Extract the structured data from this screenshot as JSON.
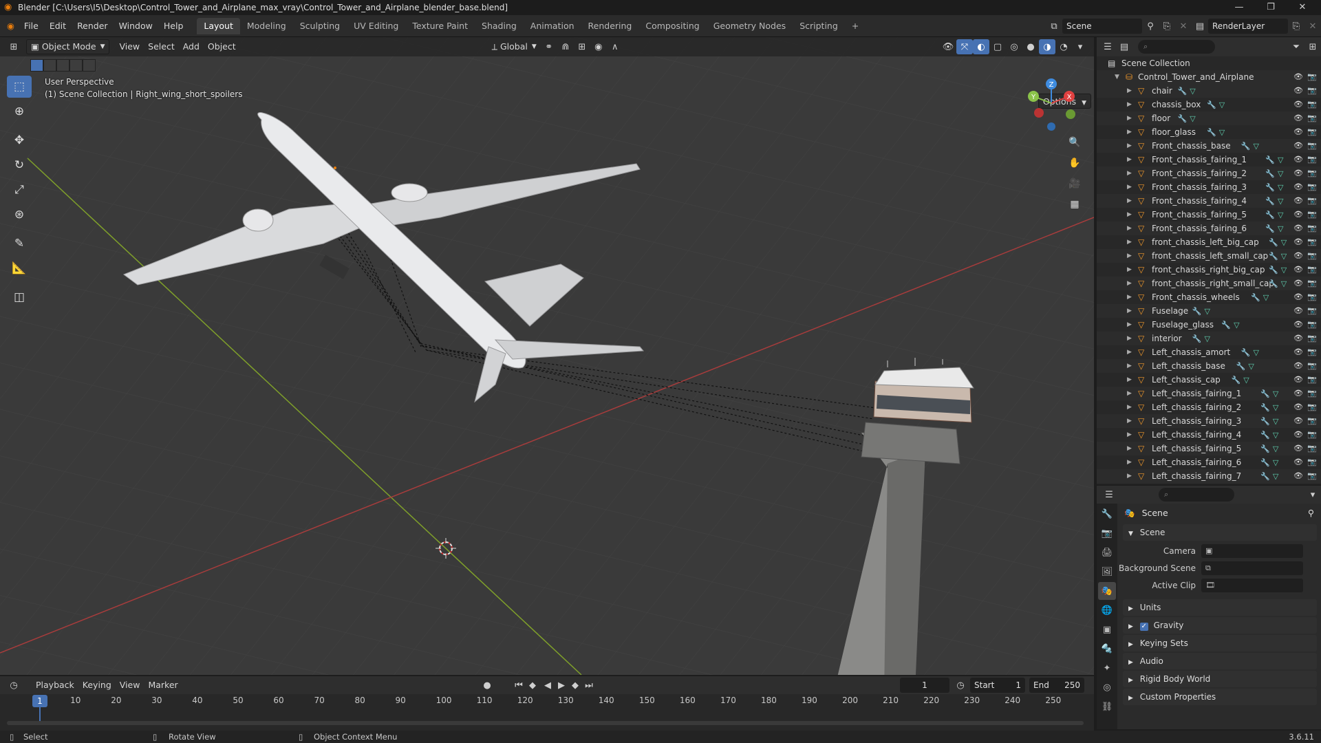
{
  "window": {
    "title": "Blender [C:\\Users\\I5\\Desktop\\Control_Tower_and_Airplane_max_vray\\Control_Tower_and_Airplane_blender_base.blend]"
  },
  "menus": [
    "File",
    "Edit",
    "Render",
    "Window",
    "Help"
  ],
  "workspaces": [
    "Layout",
    "Modeling",
    "Sculpting",
    "UV Editing",
    "Texture Paint",
    "Shading",
    "Animation",
    "Rendering",
    "Compositing",
    "Geometry Nodes",
    "Scripting"
  ],
  "active_workspace": "Layout",
  "scene_selector": {
    "scene": "Scene",
    "view_layer": "RenderLayer"
  },
  "viewport": {
    "mode": "Object Mode",
    "menus": [
      "View",
      "Select",
      "Add",
      "Object"
    ],
    "orientation": "Global",
    "options_label": "Options",
    "info_line1": "User Perspective",
    "info_line2": "(1) Scene Collection | Right_wing_short_spoilers",
    "gizmo_axes": {
      "x": "X",
      "y": "Y",
      "z": "Z"
    }
  },
  "outliner": {
    "search_placeholder": "",
    "root": "Scene Collection",
    "collection": "Control_Tower_and_Airplane",
    "objects": [
      "chair",
      "chassis_box",
      "floor",
      "floor_glass",
      "Front_chassis_base",
      "Front_chassis_fairing_1",
      "Front_chassis_fairing_2",
      "Front_chassis_fairing_3",
      "Front_chassis_fairing_4",
      "Front_chassis_fairing_5",
      "Front_chassis_fairing_6",
      "front_chassis_left_big_cap",
      "front_chassis_left_small_cap",
      "front_chassis_right_big_cap",
      "front_chassis_right_small_cap",
      "Front_chassis_wheels",
      "Fuselage",
      "Fuselage_glass",
      "interior",
      "Left_chassis_amort",
      "Left_chassis_base",
      "Left_chassis_cap",
      "Left_chassis_fairing_1",
      "Left_chassis_fairing_2",
      "Left_chassis_fairing_3",
      "Left_chassis_fairing_4",
      "Left_chassis_fairing_5",
      "Left_chassis_fairing_6",
      "Left_chassis_fairing_7"
    ]
  },
  "properties": {
    "context": "Scene",
    "panel_scene": "Scene",
    "fields": [
      {
        "label": "Camera"
      },
      {
        "label": "Background Scene"
      },
      {
        "label": "Active Clip"
      }
    ],
    "collapsed_panels": [
      "Units",
      "Gravity",
      "Keying Sets",
      "Audio",
      "Rigid Body World",
      "Custom Properties"
    ],
    "gravity_checked": true
  },
  "timeline": {
    "menus": [
      "Playback",
      "Keying",
      "View",
      "Marker"
    ],
    "current_frame": "1",
    "start_label": "Start",
    "start_value": "1",
    "end_label": "End",
    "end_value": "250",
    "ticks": [
      "10",
      "20",
      "30",
      "40",
      "50",
      "60",
      "70",
      "80",
      "90",
      "100",
      "110",
      "120",
      "130",
      "140",
      "150",
      "160",
      "170",
      "180",
      "190",
      "200",
      "210",
      "220",
      "230",
      "240",
      "250"
    ]
  },
  "statusbar": {
    "select": "Select",
    "rotate": "Rotate View",
    "context_menu": "Object Context Menu",
    "version": "3.6.11"
  },
  "colors": {
    "accent": "#4772b3",
    "object_icon": "#f39a2b",
    "axis_x": "#e04040",
    "axis_y": "#8bc34a",
    "axis_z": "#3f8ce0"
  }
}
